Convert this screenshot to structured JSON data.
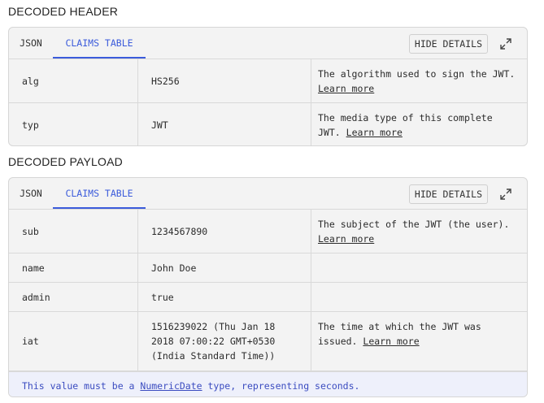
{
  "header_section": {
    "title": "DECODED HEADER",
    "tabs": [
      "JSON",
      "CLAIMS TABLE"
    ],
    "active_tab": "CLAIMS TABLE",
    "hide_details_label": "HIDE DETAILS",
    "rows": [
      {
        "claim": "alg",
        "value": "HS256",
        "description": "The algorithm used to sign the JWT.",
        "link": "Learn more"
      },
      {
        "claim": "typ",
        "value": "JWT",
        "description": "The media type of this complete JWT.",
        "link": "Learn more"
      }
    ]
  },
  "payload_section": {
    "title": "DECODED PAYLOAD",
    "tabs": [
      "JSON",
      "CLAIMS TABLE"
    ],
    "active_tab": "CLAIMS TABLE",
    "hide_details_label": "HIDE DETAILS",
    "rows": [
      {
        "claim": "sub",
        "value": "1234567890",
        "description": "The subject of the JWT (the user).",
        "link": "Learn more"
      },
      {
        "claim": "name",
        "value": "John Doe",
        "description": "",
        "link": ""
      },
      {
        "claim": "admin",
        "value": "true",
        "description": "",
        "link": ""
      },
      {
        "claim": "iat",
        "value_lines": [
          "1516239022 (Thu Jan 18",
          "2018 07:00:22 GMT+0530",
          "(India Standard Time))"
        ],
        "description": "The time at which the JWT was issued.",
        "link": "Learn more"
      }
    ],
    "note": {
      "prefix": "This value must be a ",
      "link": "NumericDate",
      "suffix": " type, representing seconds."
    }
  },
  "colors": {
    "accent": "#3b5bdb",
    "note_bg": "#eef0fb",
    "card_bg": "#f3f3f3"
  },
  "icons": [
    "expand-icon",
    "expand-icon"
  ]
}
